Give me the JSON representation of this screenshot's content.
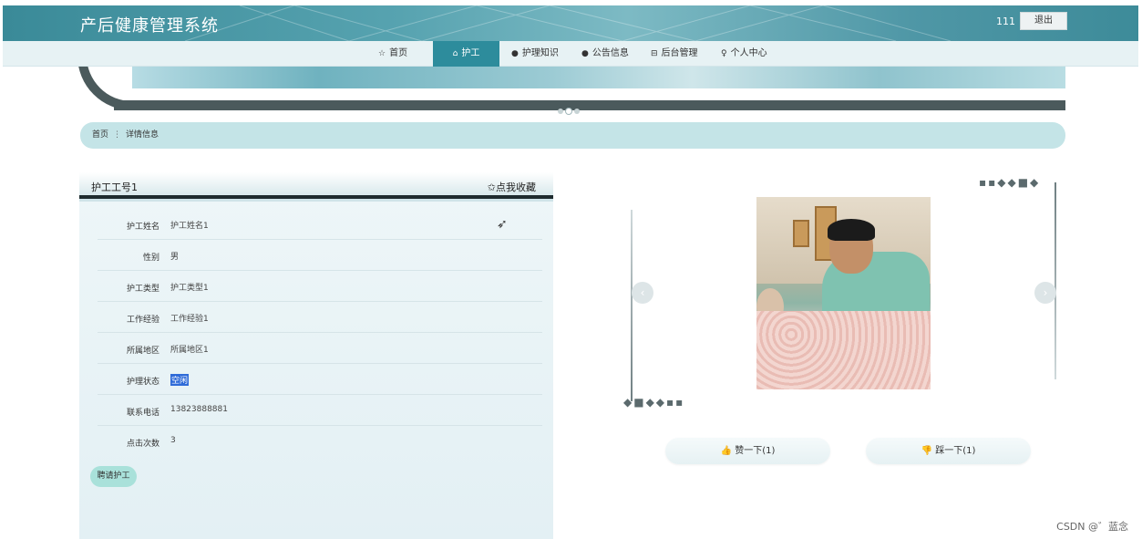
{
  "header": {
    "title": "产后健康管理系统",
    "user": "111",
    "logout_label": "退出"
  },
  "nav": {
    "items": [
      {
        "icon": "home-icon",
        "glyph": "☆",
        "label": "首页"
      },
      {
        "icon": "nurse-icon",
        "glyph": "⌂",
        "label": "护工"
      },
      {
        "icon": "info-icon",
        "glyph": "●",
        "label": "护理知识"
      },
      {
        "icon": "notice-icon",
        "glyph": "●",
        "label": "公告信息"
      },
      {
        "icon": "admin-icon",
        "glyph": "⊟",
        "label": "后台管理"
      },
      {
        "icon": "user-icon",
        "glyph": "♀",
        "label": "个人中心"
      }
    ],
    "active_index": 1
  },
  "breadcrumb": {
    "home": "首页",
    "sep": "⋮",
    "current": "详情信息"
  },
  "detail": {
    "title": "护工工号1",
    "favorite_label": "✩点我收藏",
    "fields": [
      {
        "label": "护工姓名",
        "value": "护工姓名1"
      },
      {
        "label": "性别",
        "value": "男"
      },
      {
        "label": "护工类型",
        "value": "护工类型1"
      },
      {
        "label": "工作经验",
        "value": "工作经验1"
      },
      {
        "label": "所属地区",
        "value": "所属地区1"
      },
      {
        "label": "护理状态",
        "value": "空闲"
      },
      {
        "label": "联系电话",
        "value": "13823888881"
      },
      {
        "label": "点击次数",
        "value": "3"
      }
    ],
    "hire_label": "聘请护工"
  },
  "gallery": {
    "prev_glyph": "‹",
    "next_glyph": "›"
  },
  "votes": {
    "like_label": "赞一下(1)",
    "dislike_label": "踩一下(1)"
  },
  "watermark": "CSDN @゛蓝念"
}
